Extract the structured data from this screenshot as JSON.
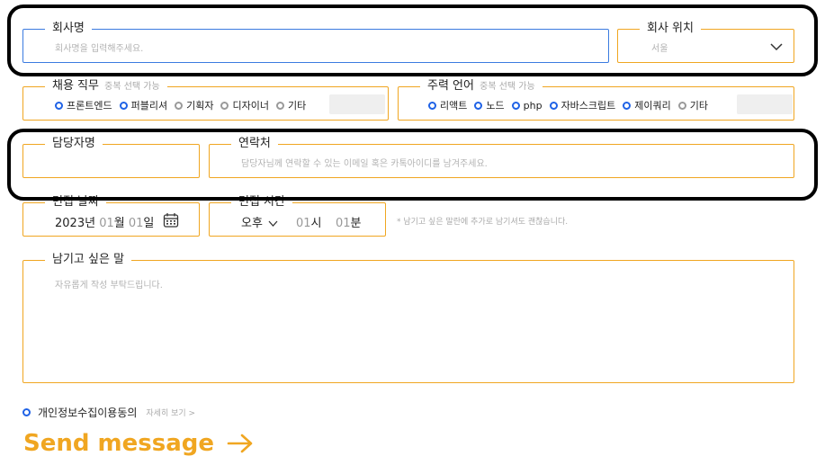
{
  "company": {
    "label": "회사명",
    "placeholder": "회사명을 입력해주세요."
  },
  "location": {
    "label": "회사 위치",
    "value": "서울"
  },
  "job": {
    "label": "채용 직무",
    "sub": "중복 선택 가능",
    "options": [
      "프론트엔드",
      "퍼블리셔",
      "기획자",
      "디자이너",
      "기타"
    ]
  },
  "lang": {
    "label": "주력 언어",
    "sub": "중복 선택 가능",
    "options": [
      "리액트",
      "노드",
      "php",
      "자바스크립트",
      "제이쿼리",
      "기타"
    ]
  },
  "manager": {
    "label": "담당자명"
  },
  "contact": {
    "label": "연락처",
    "placeholder": "담당자님께 연락할 수 있는 이메일 혹은 카톡아이디를 남겨주세요."
  },
  "interview_date": {
    "label": "면접 날짜",
    "year": "2023",
    "year_unit": "년",
    "month": "01",
    "month_unit": "월",
    "day": "01",
    "day_unit": "일"
  },
  "interview_time": {
    "label": "면접 시간",
    "ampm": "오후",
    "hour": "01",
    "hour_unit": "시",
    "minute": "01",
    "minute_unit": "분"
  },
  "time_note": "* 남기고 싶은 말란에 추가로 남기셔도 괜찮습니다.",
  "message": {
    "label": "남기고 싶은 말",
    "placeholder": "자유롭게 작성 부탁드립니다."
  },
  "consent": {
    "label": "개인정보수집이용동의",
    "link": "자세히 보기 >"
  },
  "send": {
    "label": "Send message"
  },
  "colors": {
    "accent": "#f0a621",
    "primary": "#1f62e6",
    "focus": "#3b7be0"
  }
}
